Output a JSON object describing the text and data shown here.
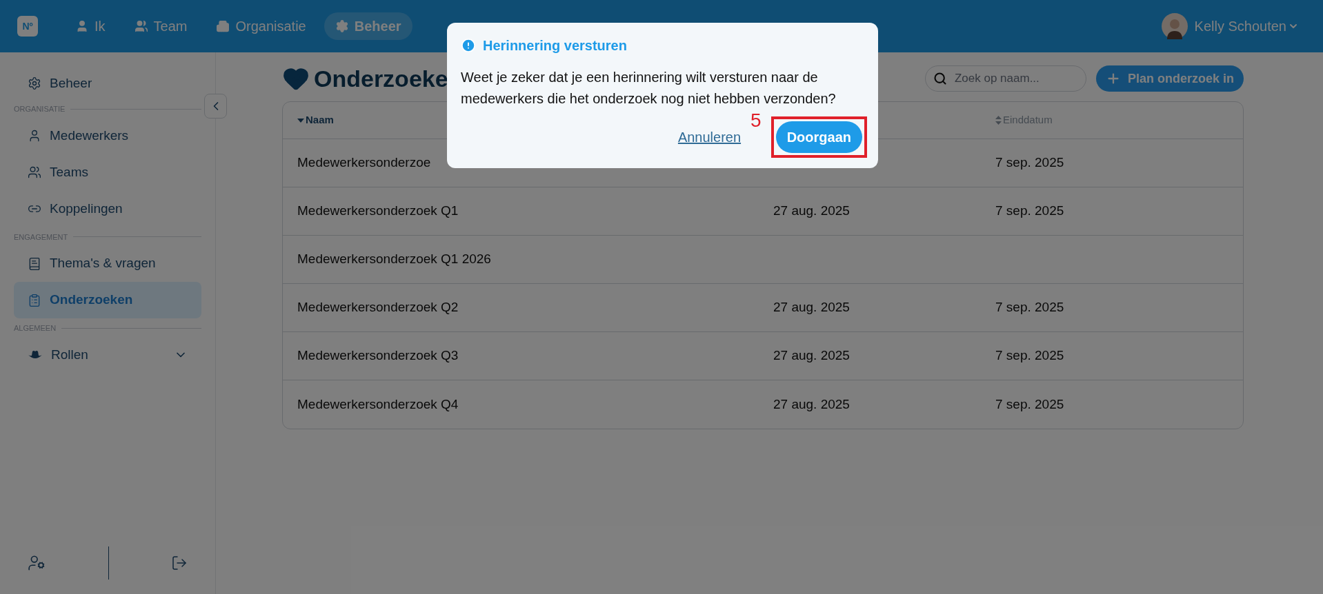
{
  "topbar": {
    "logo": "Nº",
    "items": [
      {
        "label": "Ik",
        "selected": false
      },
      {
        "label": "Team",
        "selected": false
      },
      {
        "label": "Organisatie",
        "selected": false
      },
      {
        "label": "Beheer",
        "selected": true
      }
    ],
    "user": {
      "name": "Kelly Schouten"
    }
  },
  "sidebar": {
    "top_item": {
      "label": "Beheer",
      "selected": false
    },
    "sections": [
      {
        "title": "ORGANISATIE",
        "items": [
          {
            "label": "Medewerkers",
            "selected": false
          },
          {
            "label": "Teams",
            "selected": false
          },
          {
            "label": "Koppelingen",
            "selected": false
          }
        ]
      },
      {
        "title": "ENGAGEMENT",
        "items": [
          {
            "label": "Thema's & vragen",
            "selected": false
          },
          {
            "label": "Onderzoeken",
            "selected": true
          }
        ]
      },
      {
        "title": "ALGEMEEN",
        "items": [
          {
            "label": "Rollen",
            "selected": false,
            "expanded": false
          }
        ]
      }
    ]
  },
  "page": {
    "title": "Onderzoeke",
    "search": {
      "placeholder": "Zoek op naam..."
    },
    "add_button": "Plan onderzoek in"
  },
  "table": {
    "columns": {
      "name": {
        "label": "Naam",
        "sorted": true
      },
      "end": {
        "label": "Einddatum",
        "sorted": false
      }
    },
    "rows": [
      {
        "name": "Medewerkersonderzoe",
        "end": "7 sep. 2025"
      },
      {
        "name": "Medewerkersonderzoek Q1",
        "start": "27 aug. 2025",
        "end": "7 sep. 2025"
      },
      {
        "name": "Medewerkersonderzoek Q1 2026"
      },
      {
        "name": "Medewerkersonderzoek Q2",
        "start": "27 aug. 2025",
        "end": "7 sep. 2025"
      },
      {
        "name": "Medewerkersonderzoek Q3",
        "start": "27 aug. 2025",
        "end": "7 sep. 2025"
      },
      {
        "name": "Medewerkersonderzoek Q4",
        "start": "27 aug. 2025",
        "end": "7 sep. 2025"
      }
    ]
  },
  "dialog": {
    "title": "Herinnering versturen",
    "message": "Weet je zeker dat je een herinnering wilt versturen naar de medewerkers die het onderzoek nog niet hebben verzonden?",
    "cancel": "Annuleren",
    "confirm": "Doorgaan",
    "annotation": {
      "label": "5"
    }
  }
}
